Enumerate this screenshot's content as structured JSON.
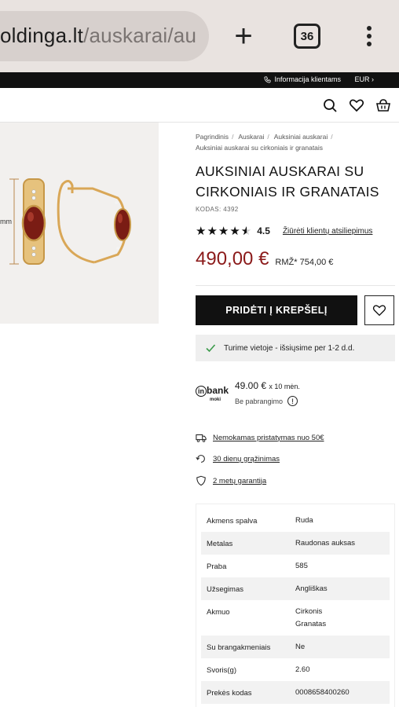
{
  "browser": {
    "url_main": "oldinga.lt",
    "url_path": "/auskarai/au",
    "tab_count": "36"
  },
  "topbar": {
    "info_label": "Informacija klientams",
    "currency": "EUR"
  },
  "breadcrumb": {
    "items": [
      "Pagrindinis",
      "Auskarai",
      "Auksiniai auskarai"
    ],
    "current": "Auksiniai auskarai su cirkoniais ir granatais"
  },
  "product": {
    "title_line1": "AUKSINIAI AUSKARAI SU",
    "title_line2": "CIRKONIAIS IR GRANATAIS",
    "code": "KODAS: 4392",
    "rating": "4.5",
    "rating_value": 4.5,
    "reviews_link": "Žiūrėti klientų atsiliepimus",
    "price": "490,00 €",
    "rrp": "RMŽ* 754,00 €",
    "measure_label": "mm",
    "add_to_cart": "PRIDĖTI Į KREPŠELĮ",
    "stock": "Turime vietoje - išsiųsime per 1-2 d.d."
  },
  "installment": {
    "logo_in": "in",
    "logo_bank": "bank",
    "logo_sub": "moki",
    "amount": "49.00 €",
    "months": "x 10 mėn.",
    "no_interest": "Be pabrangimo"
  },
  "perks": [
    {
      "icon": "truck-icon",
      "label": "Nemokamas pristatymas nuo 50€"
    },
    {
      "icon": "return-icon",
      "label": "30 dienų grąžinimas"
    },
    {
      "icon": "shield-icon",
      "label": "2 metų garantija"
    }
  ],
  "specs": [
    {
      "key": "Akmens spalva",
      "value": "Ruda"
    },
    {
      "key": "Metalas",
      "value": "Raudonas auksas"
    },
    {
      "key": "Praba",
      "value": "585"
    },
    {
      "key": "Užsegimas",
      "value": "Angliškas"
    },
    {
      "key": "Akmuo",
      "value": "Cirkonis",
      "value2": "Granatas"
    },
    {
      "key": "Su brangakmeniais",
      "value": "Ne"
    },
    {
      "key": "Svoris(g)",
      "value": "2.60"
    },
    {
      "key": "Prekės kodas",
      "value": "0008658400260"
    }
  ],
  "colors": {
    "price": "#8b1a1a",
    "button": "#111111",
    "chrome": "#e9e3e0"
  }
}
